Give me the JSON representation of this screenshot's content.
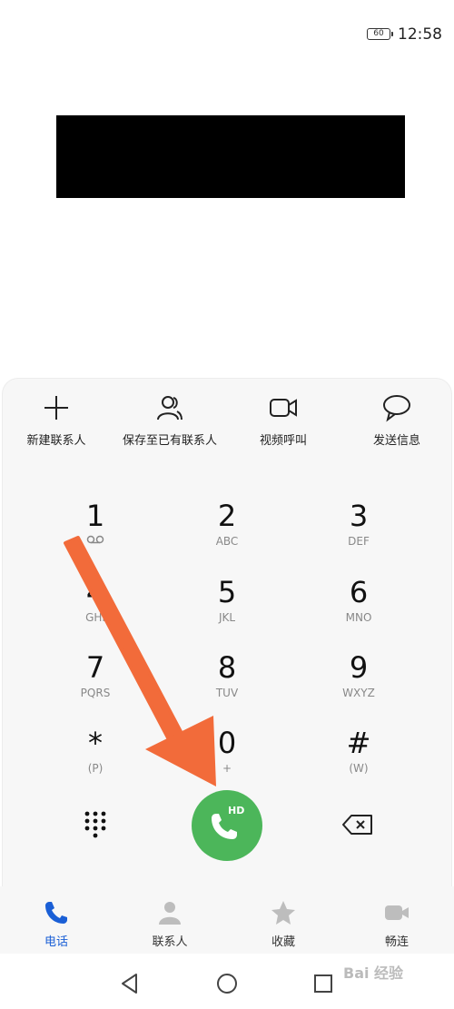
{
  "status_bar": {
    "battery": "60",
    "time": "12:58"
  },
  "actions": [
    {
      "label": "新建联系人",
      "icon": "plus-icon"
    },
    {
      "label": "保存至已有联系人",
      "icon": "person-icon"
    },
    {
      "label": "视频呼叫",
      "icon": "video-icon"
    },
    {
      "label": "发送信息",
      "icon": "message-icon"
    }
  ],
  "keypad": [
    {
      "digit": "1",
      "letters": "",
      "voicemail": true
    },
    {
      "digit": "2",
      "letters": "ABC"
    },
    {
      "digit": "3",
      "letters": "DEF"
    },
    {
      "digit": "4",
      "letters": "GHI"
    },
    {
      "digit": "5",
      "letters": "JKL"
    },
    {
      "digit": "6",
      "letters": "MNO"
    },
    {
      "digit": "7",
      "letters": "PQRS"
    },
    {
      "digit": "8",
      "letters": "TUV"
    },
    {
      "digit": "9",
      "letters": "WXYZ"
    },
    {
      "digit": "*",
      "letters": "(P)"
    },
    {
      "digit": "0",
      "letters": "+"
    },
    {
      "digit": "#",
      "letters": "(W)"
    }
  ],
  "call_button": {
    "badge": "HD",
    "color": "#4cb65a"
  },
  "tabs": [
    {
      "label": "电话",
      "icon": "phone-icon",
      "active": true
    },
    {
      "label": "联系人",
      "icon": "contacts-icon",
      "active": false
    },
    {
      "label": "收藏",
      "icon": "star-icon",
      "active": false
    },
    {
      "label": "畅连",
      "icon": "video-chat-icon",
      "active": false
    }
  ],
  "watermark": "Bai 经验",
  "colors": {
    "accent": "#1a5fd6",
    "call_green": "#4cb65a",
    "arrow": "#f26b3a"
  }
}
